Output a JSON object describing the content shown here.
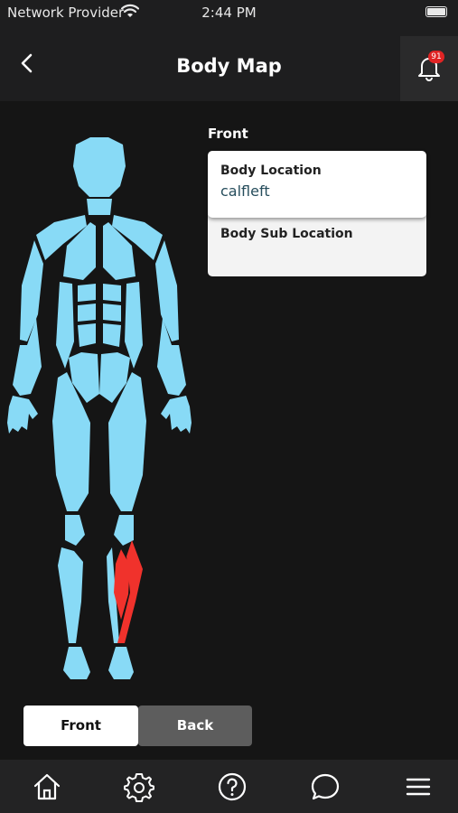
{
  "status_bar": {
    "carrier": "Network Provider",
    "time": "2:44 PM"
  },
  "header": {
    "title": "Body Map",
    "notification_count": "91"
  },
  "view_label": "Front",
  "body_location": {
    "label": "Body Location",
    "value": "calfleft"
  },
  "body_sub_location": {
    "label": "Body Sub Location",
    "value": ""
  },
  "toggle": {
    "front_label": "Front",
    "back_label": "Back",
    "selected": "Front"
  },
  "colors": {
    "body": "#88daf6",
    "highlight": "#f0322c",
    "background": "#151515"
  },
  "tabbar": {
    "items": [
      {
        "icon": "home-icon"
      },
      {
        "icon": "gear-icon"
      },
      {
        "icon": "help-icon"
      },
      {
        "icon": "chat-icon"
      },
      {
        "icon": "menu-icon"
      }
    ]
  }
}
